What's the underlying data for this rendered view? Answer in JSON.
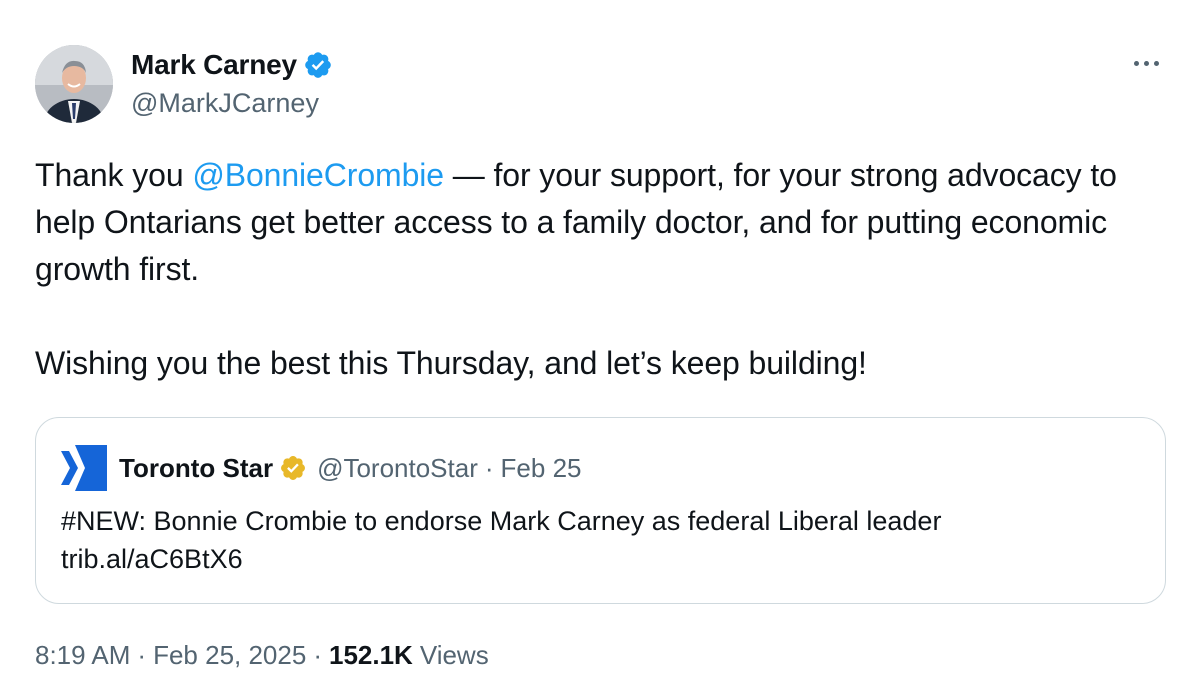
{
  "author": {
    "display_name": "Mark Carney",
    "handle": "@MarkJCarney",
    "verified_color": "#1d9bf0"
  },
  "tweet": {
    "line1_before": "Thank you ",
    "mention": "@BonnieCrombie",
    "line1_after": " — for your support, for your strong advocacy to help Ontarians get better access to a family doctor, and for putting economic growth first.",
    "line2": "Wishing you the best this Thursday, and let’s keep building!"
  },
  "quoted": {
    "name": "Toronto Star",
    "handle": "@TorontoStar",
    "separator": "·",
    "date": "Feb 25",
    "text_line1": "#NEW: Bonnie Crombie to endorse Mark Carney as federal Liberal leader",
    "text_line2": "trib.al/aC6BtX6",
    "badge_color": "#e8b829",
    "logo_color": "#1565d8"
  },
  "meta": {
    "time": "8:19 AM",
    "sep1": "·",
    "date": "Feb 25, 2025",
    "sep2": "·",
    "views_count": "152.1K",
    "views_label": "Views"
  },
  "icons": {
    "more": "more-icon",
    "verified": "verified-badge-icon",
    "org_badge": "org-verified-badge-icon",
    "logo": "toronto-star-logo-icon"
  }
}
